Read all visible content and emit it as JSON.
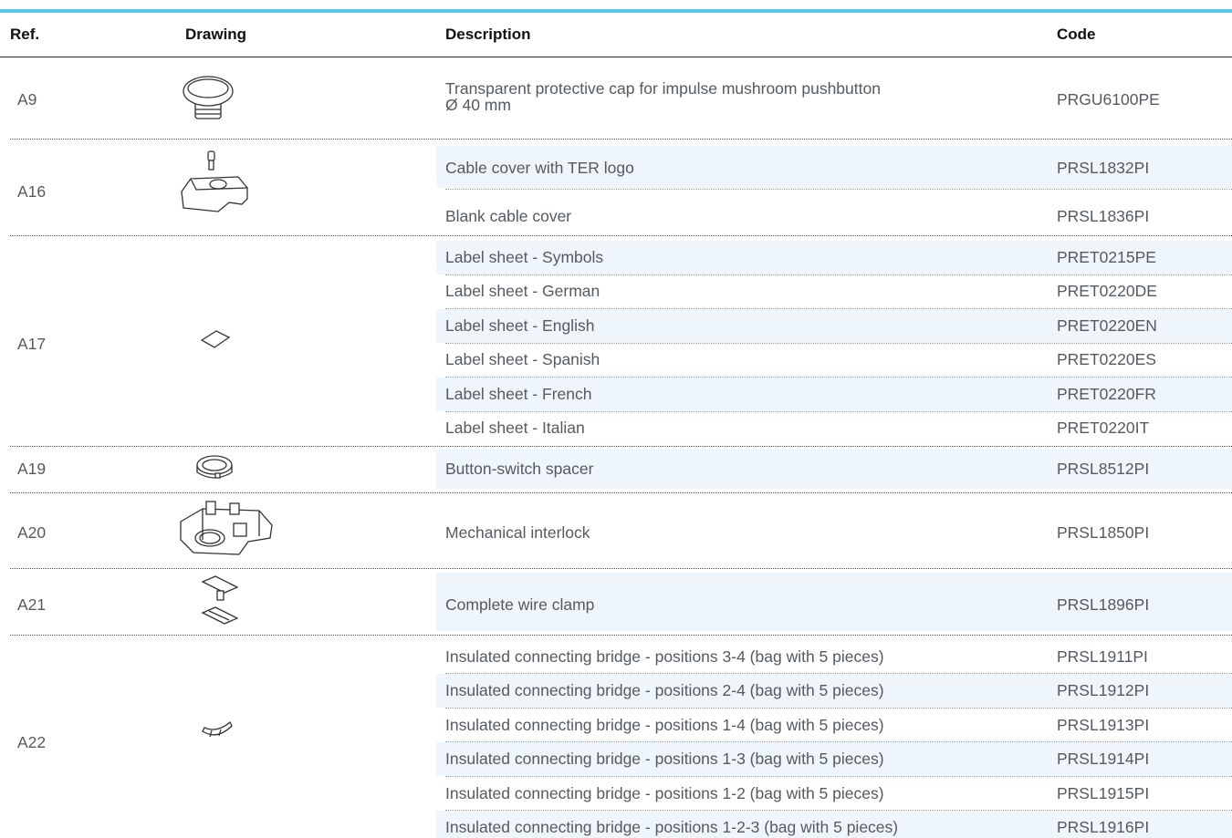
{
  "header": {
    "ref": "Ref.",
    "drawing": "Drawing",
    "description": "Description",
    "code": "Code"
  },
  "groups": [
    {
      "ref": "A9",
      "drawing_icon": "mushroom-cap-drawing-icon",
      "items": [
        {
          "description_lines": [
            "Transparent protective cap for impulse mushroom pushbutton",
            "Ø 40 mm"
          ],
          "code": "PRGU6100PE"
        }
      ]
    },
    {
      "ref": "A16",
      "drawing_icon": "cable-cover-drawing-icon",
      "items": [
        {
          "description": "Cable cover with TER logo",
          "code": "PRSL1832PI"
        },
        {
          "description": "Blank cable cover",
          "code": "PRSL1836PI"
        }
      ]
    },
    {
      "ref": "A17",
      "drawing_icon": "label-sheet-drawing-icon",
      "items": [
        {
          "description": "Label sheet - Symbols",
          "code": "PRET0215PE"
        },
        {
          "description": "Label sheet - German",
          "code": "PRET0220DE"
        },
        {
          "description": "Label sheet - English",
          "code": "PRET0220EN"
        },
        {
          "description": "Label sheet - Spanish",
          "code": "PRET0220ES"
        },
        {
          "description": "Label sheet - French",
          "code": "PRET0220FR"
        },
        {
          "description": "Label sheet - Italian",
          "code": "PRET0220IT"
        }
      ]
    },
    {
      "ref": "A19",
      "drawing_icon": "spacer-ring-drawing-icon",
      "items": [
        {
          "description": "Button-switch spacer",
          "code": "PRSL8512PI"
        }
      ]
    },
    {
      "ref": "A20",
      "drawing_icon": "interlock-drawing-icon",
      "items": [
        {
          "description": "Mechanical interlock",
          "code": "PRSL1850PI"
        }
      ]
    },
    {
      "ref": "A21",
      "drawing_icon": "wire-clamp-drawing-icon",
      "items": [
        {
          "description": "Complete wire clamp",
          "code": "PRSL1896PI"
        }
      ]
    },
    {
      "ref": "A22",
      "drawing_icon": "connecting-bridge-drawing-icon",
      "items": [
        {
          "description": "Insulated connecting bridge - positions 3-4 (bag with 5 pieces)",
          "code": "PRSL1911PI"
        },
        {
          "description": "Insulated connecting bridge - positions 2-4 (bag with 5 pieces)",
          "code": "PRSL1912PI"
        },
        {
          "description": "Insulated connecting bridge - positions 1-4 (bag with 5 pieces)",
          "code": "PRSL1913PI"
        },
        {
          "description": "Insulated connecting bridge - positions 1-3 (bag with 5 pieces)",
          "code": "PRSL1914PI"
        },
        {
          "description": "Insulated connecting bridge - positions 1-2 (bag with 5 pieces)",
          "code": "PRSL1915PI"
        },
        {
          "description": "Insulated connecting bridge - positions 1-2-3 (bag with 5 pieces)",
          "code": "PRSL1916PI"
        }
      ]
    }
  ],
  "colors": {
    "accent": "#5bc4ea",
    "row_shade": "#eef5fb",
    "text": "#555a60"
  }
}
